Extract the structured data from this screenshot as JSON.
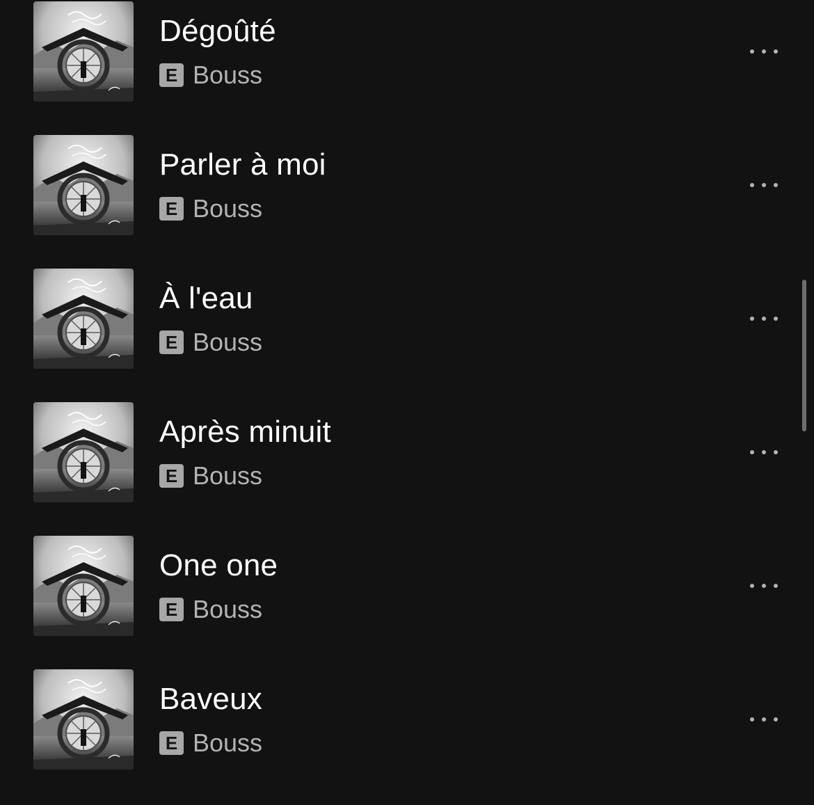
{
  "tracks": [
    {
      "title": "Dégoûté",
      "artist": "Bouss",
      "explicit_label": "E"
    },
    {
      "title": "Parler à moi",
      "artist": "Bouss",
      "explicit_label": "E"
    },
    {
      "title": "À l'eau",
      "artist": "Bouss",
      "explicit_label": "E"
    },
    {
      "title": "Après minuit",
      "artist": "Bouss",
      "explicit_label": "E"
    },
    {
      "title": "One one",
      "artist": "Bouss",
      "explicit_label": "E"
    },
    {
      "title": "Baveux",
      "artist": "Bouss",
      "explicit_label": "E"
    }
  ],
  "icons": {
    "cover": "album-cover-icon",
    "more": "more-options-icon"
  },
  "colors": {
    "background": "#121212",
    "title_text": "#ffffff",
    "secondary_text": "#b3b3b3",
    "explicit_badge": "#a7a7a7"
  }
}
